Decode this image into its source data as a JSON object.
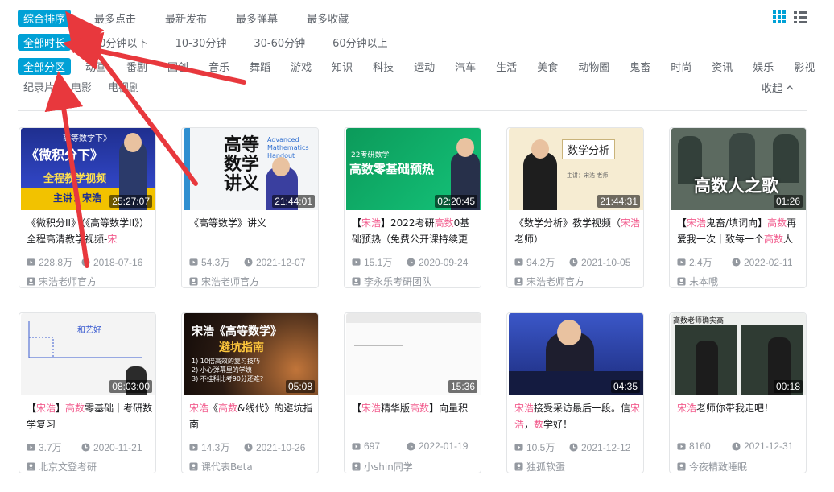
{
  "filters": {
    "sort": [
      "综合排序",
      "最多点击",
      "最新发布",
      "最多弹幕",
      "最多收藏"
    ],
    "duration": [
      "全部时长",
      "10分钟以下",
      "10-30分钟",
      "30-60分钟",
      "60分钟以上"
    ],
    "zone_row1": [
      "全部分区",
      "动画",
      "番剧",
      "国创",
      "音乐",
      "舞蹈",
      "游戏",
      "知识",
      "科技",
      "运动",
      "汽车",
      "生活",
      "美食",
      "动物圈",
      "鬼畜",
      "时尚",
      "资讯",
      "娱乐",
      "影视"
    ],
    "zone_row2": [
      "纪录片",
      "电影",
      "电视剧"
    ],
    "collapse_label": "收起"
  },
  "videos": [
    {
      "duration": "25:27:07",
      "title_parts": [
        [
          "《微积分II》（《高等数学II》）全程高清教学视频-",
          ""
        ],
        [
          "宋",
          "hl"
        ]
      ],
      "views": "228.8万",
      "date": "2018-07-16",
      "author": "宋浩老师官方",
      "thumb_text": "《微积分下》",
      "thumb_sub": "全程教学视频",
      "thumb_top": "高等数学下》",
      "thumb_host": "主讲：宋浩"
    },
    {
      "duration": "21:44:01",
      "title_parts": [
        [
          "《高等数学》讲义",
          ""
        ]
      ],
      "views": "54.3万",
      "date": "2021-12-07",
      "author": "宋浩老师官方",
      "thumb_text": "高等数学讲义",
      "thumb_sub": "Advanced Mathematics Handout"
    },
    {
      "duration": "02:20:45",
      "title_parts": [
        [
          "【",
          ""
        ],
        [
          "宋浩",
          "hl"
        ],
        [
          "】2022考研",
          ""
        ],
        [
          "高数",
          "hl"
        ],
        [
          "0基础预热（免费公开课持续更",
          ""
        ]
      ],
      "views": "15.1万",
      "date": "2020-09-24",
      "author": "李永乐考研团队",
      "thumb_text": "高数零基础预热",
      "thumb_sub": "22考研数学"
    },
    {
      "duration": "21:44:31",
      "title_parts": [
        [
          "《数学分析》教学视频（",
          ""
        ],
        [
          "宋浩",
          "hl"
        ],
        [
          " 老师）",
          ""
        ]
      ],
      "views": "94.2万",
      "date": "2021-10-05",
      "author": "宋浩老师官方",
      "thumb_text": "数学分析",
      "thumb_sub": "主讲：宋浩 老师"
    },
    {
      "duration": "01:26",
      "title_parts": [
        [
          "【",
          ""
        ],
        [
          "宋浩",
          "hl"
        ],
        [
          "鬼畜/填词向】",
          ""
        ],
        [
          "高数",
          "hl"
        ],
        [
          "再爱我一次｜致每一个",
          ""
        ],
        [
          "高数",
          "hl"
        ],
        [
          "人",
          ""
        ]
      ],
      "views": "2.4万",
      "date": "2022-02-11",
      "author": "末本哦",
      "thumb_text": "高数人之歌"
    },
    {
      "duration": "08:03:00",
      "title_parts": [
        [
          "【",
          ""
        ],
        [
          "宋浩",
          "hl"
        ],
        [
          "】",
          ""
        ],
        [
          "高数",
          "hl"
        ],
        [
          "零基础｜考研数学复习",
          ""
        ]
      ],
      "views": "3.7万",
      "date": "2020-11-21",
      "author": "北京文登考研",
      "thumb_text": "和艺好"
    },
    {
      "duration": "05:08",
      "title_parts": [
        [
          "宋浩",
          "hl"
        ],
        [
          "《",
          ""
        ],
        [
          "高数",
          "hl"
        ],
        [
          "&线代》的避坑指南",
          ""
        ]
      ],
      "views": "14.3万",
      "date": "2021-10-26",
      "author": "课代表Beta",
      "thumb_text": "宋浩《高等数学》",
      "thumb_sub": "避坑指南",
      "thumb_lines": [
        "1) 10倍高效的复习技巧",
        "2) 小心弹幕里的学姨",
        "3) 不挂科比考90分还难?"
      ]
    },
    {
      "duration": "15:36",
      "title_parts": [
        [
          "【",
          ""
        ],
        [
          "宋浩",
          "hl"
        ],
        [
          "精华版",
          ""
        ],
        [
          "高数",
          "hl"
        ],
        [
          "】向量积",
          ""
        ]
      ],
      "views": "697",
      "date": "2022-01-19",
      "author": "小shin同学",
      "thumb_text": ""
    },
    {
      "duration": "04:35",
      "title_parts": [
        [
          "宋浩",
          "hl"
        ],
        [
          "接受采访最后一段。信",
          ""
        ],
        [
          "宋浩",
          "hl"
        ],
        [
          "，",
          ""
        ],
        [
          "数",
          "hl"
        ],
        [
          "学好！",
          ""
        ]
      ],
      "views": "10.5万",
      "date": "2021-12-12",
      "author": "独孤软蛋",
      "thumb_text": ""
    },
    {
      "duration": "00:18",
      "title_parts": [
        [
          "宋浩",
          "hl"
        ],
        [
          "老师你带我走吧！",
          ""
        ]
      ],
      "views": "8160",
      "date": "2021-12-31",
      "author": "今夜精致睡眠",
      "thumb_text": "高数老师确实高"
    }
  ],
  "colors": {
    "accent": "#00a1d6",
    "highlight": "#f25d8e",
    "arrow": "#e8383d",
    "meta": "#9499a0"
  }
}
